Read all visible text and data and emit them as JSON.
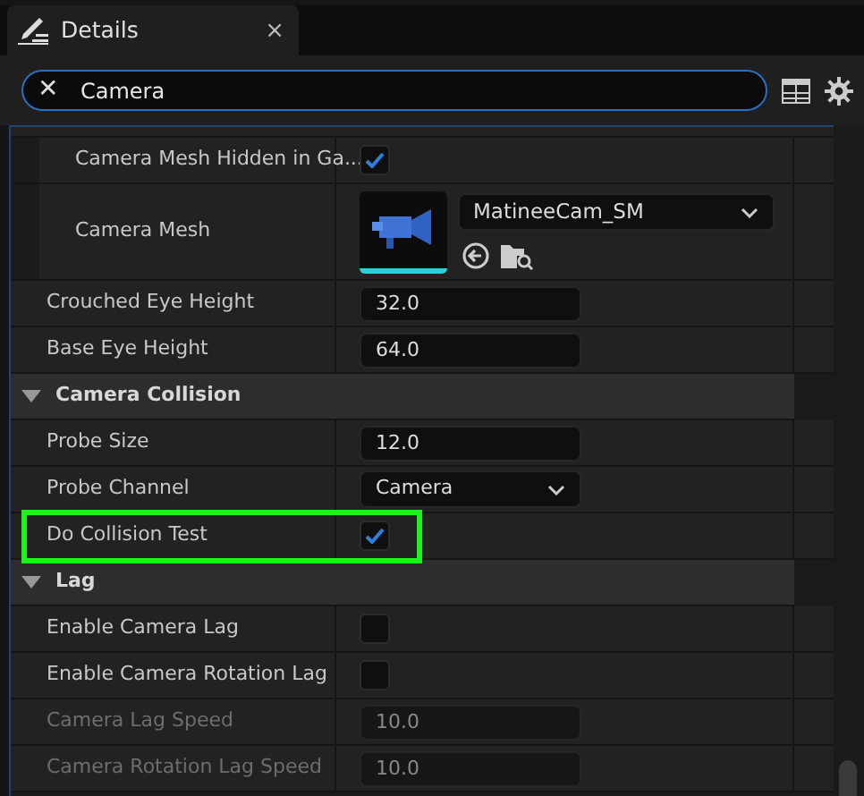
{
  "tab": {
    "title": "Details",
    "close": "×"
  },
  "search": {
    "value": "Camera",
    "clear": "✕"
  },
  "rows": [
    {
      "kind": "checkbox",
      "label": "Camera Mesh Hidden in Ga...",
      "checked": true,
      "indent": true
    },
    {
      "kind": "mesh",
      "label": "Camera Mesh",
      "value": "MatineeCam_SM",
      "indent": true
    },
    {
      "kind": "number",
      "label": "Crouched Eye Height",
      "value": "32.0"
    },
    {
      "kind": "number",
      "label": "Base Eye Height",
      "value": "64.0"
    },
    {
      "kind": "section",
      "label": "Camera Collision",
      "expanded": true
    },
    {
      "kind": "number",
      "label": "Probe Size",
      "value": "12.0"
    },
    {
      "kind": "dropdown",
      "label": "Probe Channel",
      "value": "Camera"
    },
    {
      "kind": "checkbox",
      "label": "Do Collision Test",
      "checked": true,
      "highlighted": true
    },
    {
      "kind": "section",
      "label": "Lag",
      "expanded": true
    },
    {
      "kind": "checkbox",
      "label": "Enable Camera Lag",
      "checked": false
    },
    {
      "kind": "checkbox",
      "label": "Enable Camera Rotation Lag",
      "checked": false
    },
    {
      "kind": "number",
      "label": "Camera Lag Speed",
      "value": "10.0",
      "disabled": true
    },
    {
      "kind": "number",
      "label": "Camera Rotation Lag Speed",
      "value": "10.0",
      "disabled": true
    }
  ]
}
